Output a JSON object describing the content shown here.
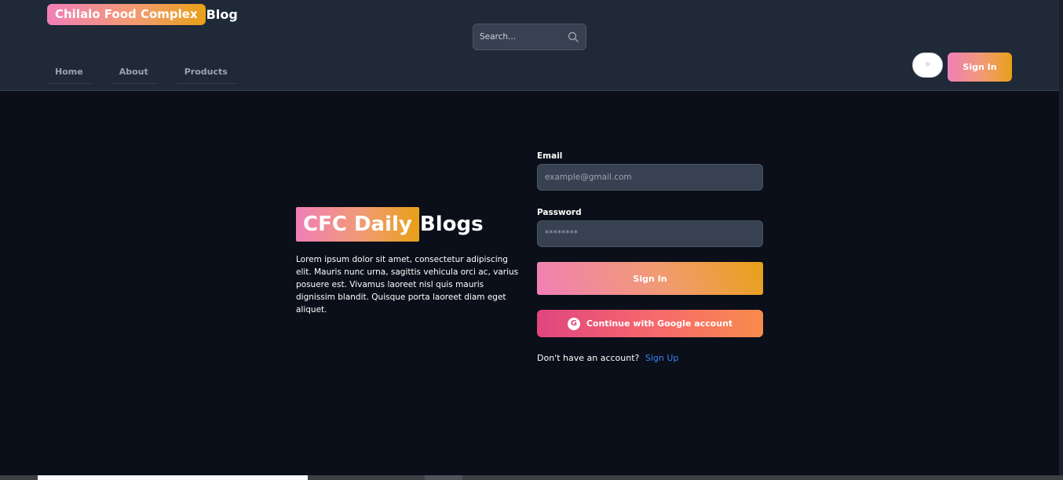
{
  "header": {
    "brand_highlight": "Chilalo Food Complex",
    "brand_tail": "Blog",
    "search_placeholder": "Search...",
    "nav": [
      "Home",
      "About",
      "Products"
    ],
    "theme_icon": "sun-icon",
    "signin_label": "Sign In"
  },
  "hero": {
    "title_highlight": "CFC Daily",
    "title_tail": "Blogs",
    "text": "Lorem ipsum dolor sit amet, consectetur adipiscing elit. Mauris nunc urna, sagittis vehicula orci ac, varius posuere est. Vivamus laoreet nisl quis mauris dignissim blandit. Quisque porta laoreet diam eget aliquet."
  },
  "form": {
    "email_label": "Email",
    "email_placeholder": "example@gmail.com",
    "password_label": "Password",
    "password_placeholder": "********",
    "submit_label": "Sign In",
    "google_label": "Continue with Google account",
    "google_icon_letter": "G",
    "signup_prompt": "Don't have an account?",
    "signup_link": "Sign Up"
  },
  "colors": {
    "accent_gradient_start": "#f07fb8",
    "accent_gradient_end": "#e8a117",
    "header_bg": "#1f2937",
    "page_bg": "#0b0f19",
    "link": "#3b82f6"
  }
}
